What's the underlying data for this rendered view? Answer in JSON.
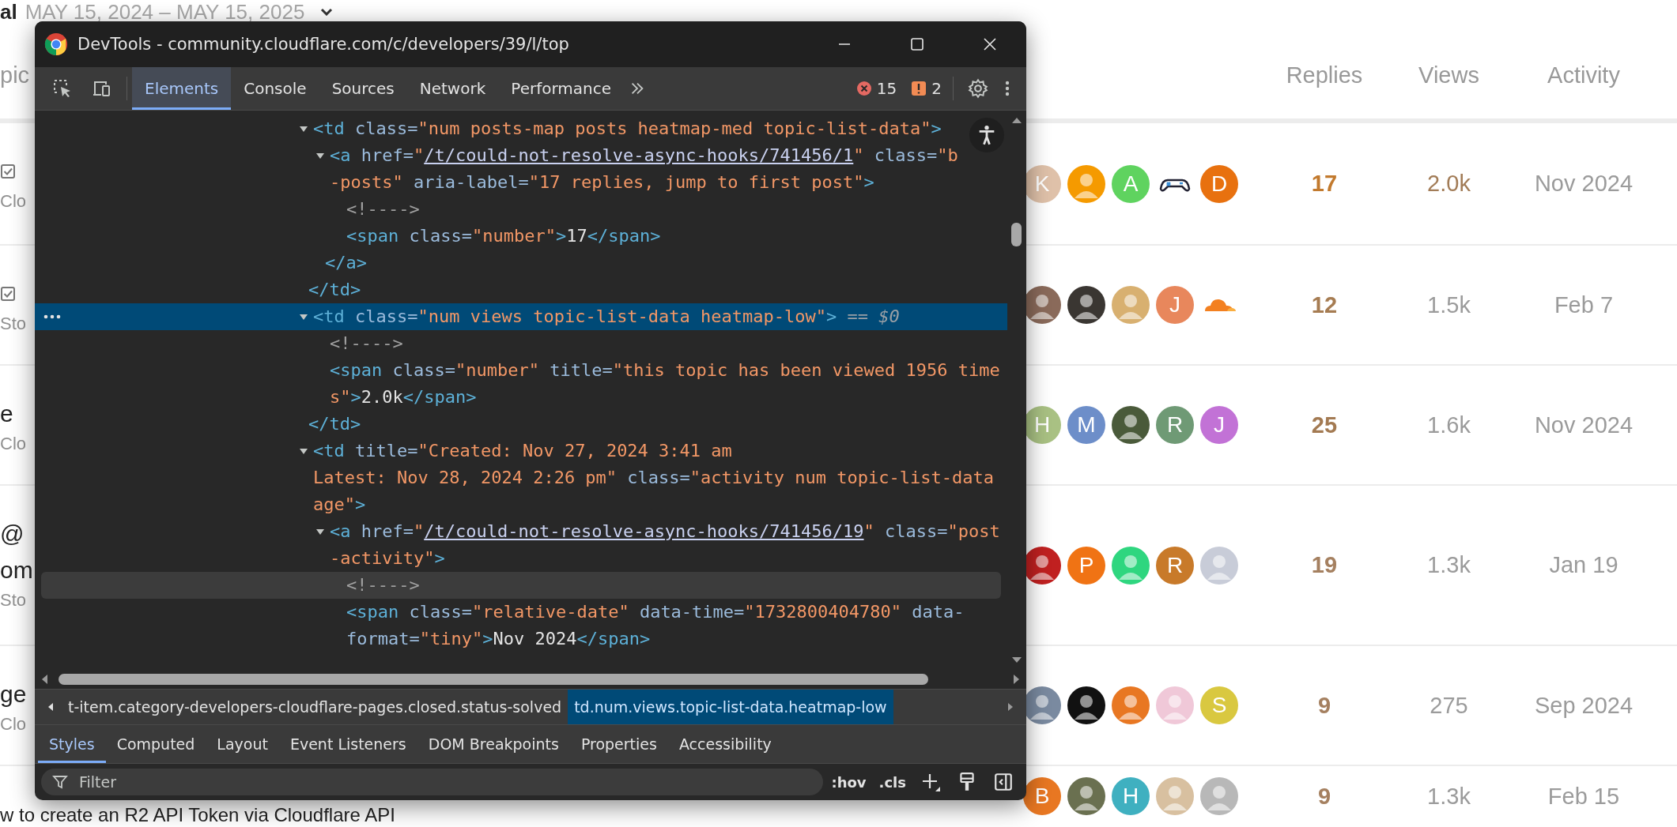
{
  "page": {
    "period": {
      "prefix": "al",
      "range": "MAY 15, 2024 – MAY 15, 2025"
    },
    "columns": {
      "topic": "pic",
      "replies": "Replies",
      "views": "Views",
      "activity": "Activity"
    },
    "topics": [
      {
        "solved": true,
        "category": "Clo",
        "posters": [
          {
            "kind": "letter",
            "letter": "K",
            "color": "#dfc1a9"
          },
          {
            "kind": "photo",
            "color": "#f59a00"
          },
          {
            "kind": "letter",
            "letter": "A",
            "color": "#5fd35f"
          },
          {
            "kind": "gamepad"
          },
          {
            "kind": "letter",
            "letter": "D",
            "color": "#e8710f"
          }
        ],
        "replies": {
          "text": "17",
          "color": "#c27a2e"
        },
        "views": {
          "text": "2.0k",
          "color": "#a27c57"
        },
        "activity": "Nov 2024"
      },
      {
        "solved": true,
        "category": "Sto",
        "posters": [
          {
            "kind": "photo",
            "color": "#8a6a5a"
          },
          {
            "kind": "photo",
            "color": "#3a3632"
          },
          {
            "kind": "photo",
            "color": "#d8b070"
          },
          {
            "kind": "letter",
            "letter": "J",
            "color": "#e8875c"
          },
          {
            "kind": "cloud"
          }
        ],
        "replies": {
          "text": "12",
          "color": "#a67c52"
        },
        "views": {
          "text": "1.5k",
          "color": "#9b9b9b"
        },
        "activity": "Feb 7"
      },
      {
        "solved": false,
        "title_lines": [
          "e"
        ],
        "category": "Clo",
        "posters": [
          {
            "kind": "letter",
            "letter": "H",
            "color": "#a9c183"
          },
          {
            "kind": "letter",
            "letter": "M",
            "color": "#6d8ec9"
          },
          {
            "kind": "photo",
            "color": "#4a5a3a"
          },
          {
            "kind": "letter",
            "letter": "R",
            "color": "#6f9a75"
          },
          {
            "kind": "letter",
            "letter": "J",
            "color": "#c272d6"
          }
        ],
        "replies": {
          "text": "25",
          "color": "#a37a52"
        },
        "views": {
          "text": "1.6k",
          "color": "#9b9b9b"
        },
        "activity": "Nov 2024"
      },
      {
        "solved": false,
        "title_lines": [
          "@",
          "om"
        ],
        "category": "Sto",
        "posters": [
          {
            "kind": "photo",
            "color": "#c02020"
          },
          {
            "kind": "letter",
            "letter": "P",
            "color": "#f07314"
          },
          {
            "kind": "photo",
            "color": "#2fd67f"
          },
          {
            "kind": "letter",
            "letter": "R",
            "color": "#c87a2a"
          },
          {
            "kind": "photo",
            "color": "#c8ccd8"
          }
        ],
        "replies": {
          "text": "19",
          "color": "#a58060"
        },
        "views": {
          "text": "1.3k",
          "color": "#9b9b9b"
        },
        "activity": "Jan 19"
      },
      {
        "solved": false,
        "title_lines": [
          "ge"
        ],
        "category": "Clo",
        "posters": [
          {
            "kind": "photo",
            "color": "#7a8aa0"
          },
          {
            "kind": "photo",
            "color": "#111111"
          },
          {
            "kind": "photo",
            "color": "#e87722"
          },
          {
            "kind": "photo",
            "color": "#f0c8d8"
          },
          {
            "kind": "letter",
            "letter": "S",
            "color": "#d9c840"
          }
        ],
        "replies": {
          "text": "9",
          "color": "#a58060"
        },
        "views": {
          "text": "275",
          "color": "#9b9b9b"
        },
        "activity": "Sep 2024"
      },
      {
        "solved": false,
        "title_lines": [
          "w to create an R2 API Token via Cloudflare API"
        ],
        "posters": [
          {
            "kind": "letter",
            "letter": "B",
            "color": "#e87722"
          },
          {
            "kind": "photo",
            "color": "#6a7050"
          },
          {
            "kind": "letter",
            "letter": "H",
            "color": "#3fb0c0"
          },
          {
            "kind": "photo",
            "color": "#d8c0a0"
          },
          {
            "kind": "photo",
            "color": "#b8b8b8"
          }
        ],
        "replies": {
          "text": "9",
          "color": "#a58060"
        },
        "views": {
          "text": "1.3k",
          "color": "#9b9b9b"
        },
        "activity": "Feb 15"
      }
    ]
  },
  "devtools": {
    "title": "DevTools - community.cloudflare.com/c/developers/39/l/top",
    "tabs": [
      {
        "label": "Elements",
        "selected": true
      },
      {
        "label": "Console",
        "selected": false
      },
      {
        "label": "Sources",
        "selected": false
      },
      {
        "label": "Network",
        "selected": false
      },
      {
        "label": "Performance",
        "selected": false
      }
    ],
    "errors": "15",
    "warnings": "2",
    "tree": [
      {
        "expanded": true,
        "selected": false,
        "hovered": false,
        "lines": [
          [
            {
              "kind": "tag",
              "text": "<td"
            },
            {
              "kind": "attr",
              "text": " class="
            },
            {
              "kind": "value",
              "text": "\"num posts-map posts heatmap-med topic-list-data\""
            },
            {
              "kind": "tag",
              "text": ">"
            }
          ]
        ],
        "children": [
          {
            "expanded": true,
            "selected": false,
            "hovered": false,
            "lines": [
              [
                {
                  "kind": "tag",
                  "text": "<a"
                },
                {
                  "kind": "attr",
                  "text": " href="
                },
                {
                  "kind": "value",
                  "text": "\""
                },
                {
                  "kind": "link",
                  "text": "/t/could-not-resolve-async-hooks/741456/1"
                },
                {
                  "kind": "value",
                  "text": "\""
                },
                {
                  "kind": "attr",
                  "text": " class="
                },
                {
                  "kind": "value",
                  "text": "\"b"
                }
              ],
              [
                {
                  "kind": "value",
                  "text": "-posts\""
                },
                {
                  "kind": "attr",
                  "text": " aria-label="
                },
                {
                  "kind": "value",
                  "text": "\"17 replies, jump to first post\""
                },
                {
                  "kind": "tag",
                  "text": ">"
                }
              ]
            ],
            "children": [
              {
                "selected": false,
                "hovered": false,
                "lines": [
                  [
                    {
                      "kind": "comment",
                      "text": "<!---->"
                    }
                  ]
                ]
              },
              {
                "selected": false,
                "hovered": false,
                "lines": [
                  [
                    {
                      "kind": "tag",
                      "text": "<span"
                    },
                    {
                      "kind": "attr",
                      "text": " class="
                    },
                    {
                      "kind": "value",
                      "text": "\"number\""
                    },
                    {
                      "kind": "tag",
                      "text": ">"
                    },
                    {
                      "kind": "text",
                      "text": "17"
                    },
                    {
                      "kind": "tag",
                      "text": "</span>"
                    }
                  ]
                ]
              }
            ],
            "close": [
              {
                "kind": "tag",
                "text": "</a>"
              }
            ]
          }
        ],
        "close": [
          {
            "kind": "tag",
            "text": "</td>"
          }
        ]
      },
      {
        "expanded": true,
        "selected": true,
        "hovered": false,
        "lines": [
          [
            {
              "kind": "tag",
              "text": "<td"
            },
            {
              "kind": "attr",
              "text": " class="
            },
            {
              "kind": "value",
              "text": "\"num views topic-list-data heatmap-low\""
            },
            {
              "kind": "tag",
              "text": ">"
            },
            {
              "kind": "note",
              "text": " == "
            },
            {
              "kind": "var",
              "text": "$0"
            }
          ]
        ],
        "children": [
          {
            "selected": false,
            "hovered": false,
            "lines": [
              [
                {
                  "kind": "comment",
                  "text": "<!---->"
                }
              ]
            ]
          },
          {
            "selected": false,
            "hovered": false,
            "lines": [
              [
                {
                  "kind": "tag",
                  "text": "<span"
                },
                {
                  "kind": "attr",
                  "text": " class="
                },
                {
                  "kind": "value",
                  "text": "\"number\""
                },
                {
                  "kind": "attr",
                  "text": " title="
                },
                {
                  "kind": "value",
                  "text": "\"this topic has been viewed 1956 time"
                }
              ],
              [
                {
                  "kind": "value",
                  "text": "s\""
                },
                {
                  "kind": "tag",
                  "text": ">"
                },
                {
                  "kind": "text",
                  "text": "2.0k"
                },
                {
                  "kind": "tag",
                  "text": "</span>"
                }
              ]
            ]
          }
        ],
        "close": [
          {
            "kind": "tag",
            "text": "</td>"
          }
        ]
      },
      {
        "expanded": true,
        "selected": false,
        "hovered": false,
        "lines": [
          [
            {
              "kind": "tag",
              "text": "<td"
            },
            {
              "kind": "attr",
              "text": " title="
            },
            {
              "kind": "value",
              "text": "\"Created: Nov 27, 2024 3:41 am"
            }
          ],
          [
            {
              "kind": "value",
              "text": "Latest: Nov 28, 2024 2:26 pm\""
            },
            {
              "kind": "attr",
              "text": " class="
            },
            {
              "kind": "value",
              "text": "\"activity num topic-list-data"
            }
          ],
          [
            {
              "kind": "value",
              "text": "age\""
            },
            {
              "kind": "tag",
              "text": ">"
            }
          ]
        ],
        "children": [
          {
            "expanded": true,
            "selected": false,
            "hovered": false,
            "lines": [
              [
                {
                  "kind": "tag",
                  "text": "<a"
                },
                {
                  "kind": "attr",
                  "text": " href="
                },
                {
                  "kind": "value",
                  "text": "\""
                },
                {
                  "kind": "link",
                  "text": "/t/could-not-resolve-async-hooks/741456/19"
                },
                {
                  "kind": "value",
                  "text": "\""
                },
                {
                  "kind": "attr",
                  "text": " class="
                },
                {
                  "kind": "value",
                  "text": "\"post"
                }
              ],
              [
                {
                  "kind": "value",
                  "text": "-activity\""
                },
                {
                  "kind": "tag",
                  "text": ">"
                }
              ]
            ],
            "children": [
              {
                "selected": false,
                "hovered": true,
                "lines": [
                  [
                    {
                      "kind": "comment",
                      "text": "<!---->"
                    }
                  ]
                ]
              },
              {
                "selected": false,
                "hovered": false,
                "lines": [
                  [
                    {
                      "kind": "tag",
                      "text": "<span"
                    },
                    {
                      "kind": "attr",
                      "text": " class="
                    },
                    {
                      "kind": "value",
                      "text": "\"relative-date\""
                    },
                    {
                      "kind": "attr",
                      "text": " data-time="
                    },
                    {
                      "kind": "value",
                      "text": "\"1732800404780\""
                    },
                    {
                      "kind": "attr",
                      "text": " data-"
                    }
                  ],
                  [
                    {
                      "kind": "attr",
                      "text": "format="
                    },
                    {
                      "kind": "value",
                      "text": "\"tiny\""
                    },
                    {
                      "kind": "tag",
                      "text": ">"
                    },
                    {
                      "kind": "text",
                      "text": "Nov 2024"
                    },
                    {
                      "kind": "tag",
                      "text": "</span>"
                    }
                  ]
                ]
              }
            ]
          }
        ]
      }
    ],
    "breadcrumbs": [
      {
        "label": "t-item.category-developers-cloudflare-pages.closed.status-solved",
        "selected": false
      },
      {
        "label": "td.num.views.topic-list-data.heatmap-low",
        "selected": true
      }
    ],
    "panel_tabs": [
      {
        "label": "Styles",
        "selected": true
      },
      {
        "label": "Computed",
        "selected": false
      },
      {
        "label": "Layout",
        "selected": false
      },
      {
        "label": "Event Listeners",
        "selected": false
      },
      {
        "label": "DOM Breakpoints",
        "selected": false
      },
      {
        "label": "Properties",
        "selected": false
      },
      {
        "label": "Accessibility",
        "selected": false
      }
    ],
    "filter": {
      "placeholder": "Filter"
    },
    "style_buttons": [
      ":hov",
      ".cls"
    ]
  }
}
